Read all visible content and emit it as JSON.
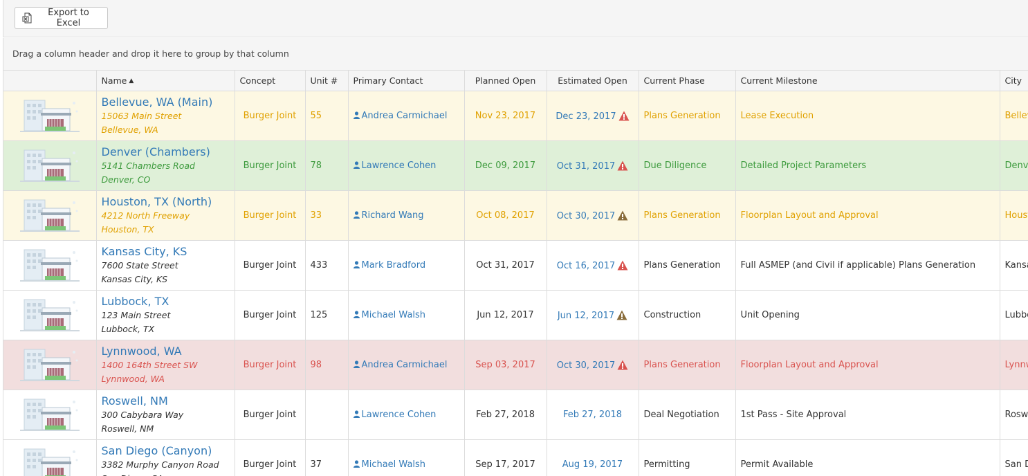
{
  "toolbar": {
    "export_label": "Export to Excel"
  },
  "group_panel": {
    "hint": "Drag a column header and drop it here to group by that column"
  },
  "columns": {
    "name": "Name",
    "concept": "Concept",
    "unit": "Unit #",
    "contact": "Primary Contact",
    "planned": "Planned Open",
    "estimated": "Estimated Open",
    "phase": "Current Phase",
    "milestone": "Current Milestone",
    "city": "City"
  },
  "sort": {
    "column": "name",
    "direction": "ascending"
  },
  "colors": {
    "link": "#337ab7",
    "warning_red": "#d9534f",
    "warning_brown": "#8a6d3b",
    "row_yellow_bg": "#fdf8e3",
    "row_green_bg": "#dff0d8",
    "row_red_bg": "#f2dede"
  },
  "rows": [
    {
      "status": "yellow",
      "name": "Bellevue, WA (Main)",
      "street": "15063 Main Street",
      "citystate": "Bellevue, WA",
      "concept": "Burger Joint",
      "unit": "55",
      "contact": "Andrea Carmichael",
      "planned": "Nov 23, 2017",
      "estimated": "Dec 23, 2017",
      "warning": "red",
      "phase": "Plans Generation",
      "milestone": "Lease Execution",
      "city": "Bellevue"
    },
    {
      "status": "green",
      "name": "Denver (Chambers)",
      "street": "5141 Chambers Road",
      "citystate": "Denver, CO",
      "concept": "Burger Joint",
      "unit": "78",
      "contact": "Lawrence Cohen",
      "planned": "Dec 09, 2017",
      "estimated": "Oct 31, 2017",
      "warning": "red",
      "phase": "Due Diligence",
      "milestone": "Detailed Project Parameters",
      "city": "Denver"
    },
    {
      "status": "yellow",
      "name": "Houston, TX (North)",
      "street": "4212 North Freeway",
      "citystate": "Houston, TX",
      "concept": "Burger Joint",
      "unit": "33",
      "contact": "Richard Wang",
      "planned": "Oct 08, 2017",
      "estimated": "Oct 30, 2017",
      "warning": "brown",
      "phase": "Plans Generation",
      "milestone": "Floorplan Layout and Approval",
      "city": "Houston"
    },
    {
      "status": "plain",
      "name": "Kansas City, KS",
      "street": "7600 State Street",
      "citystate": "Kansas City, KS",
      "concept": "Burger Joint",
      "unit": "433",
      "contact": "Mark Bradford",
      "planned": "Oct 31, 2017",
      "estimated": "Oct 16, 2017",
      "warning": "red",
      "phase": "Plans Generation",
      "milestone": "Full ASMEP (and Civil if applicable) Plans Generation",
      "city": "Kansas City"
    },
    {
      "status": "plain",
      "name": "Lubbock, TX",
      "street": "123 Main Street",
      "citystate": "Lubbock, TX",
      "concept": "Burger Joint",
      "unit": "125",
      "contact": "Michael Walsh",
      "planned": "Jun 12, 2017",
      "estimated": "Jun 12, 2017",
      "warning": "brown",
      "phase": "Construction",
      "milestone": "Unit Opening",
      "city": "Lubbock"
    },
    {
      "status": "red",
      "name": "Lynnwood, WA",
      "street": "1400 164th Street SW",
      "citystate": "Lynnwood, WA",
      "concept": "Burger Joint",
      "unit": "98",
      "contact": "Andrea Carmichael",
      "planned": "Sep 03, 2017",
      "estimated": "Oct 30, 2017",
      "warning": "red",
      "phase": "Plans Generation",
      "milestone": "Floorplan Layout and Approval",
      "city": "Lynnwood"
    },
    {
      "status": "plain",
      "name": "Roswell, NM",
      "street": "300 Cabybara Way",
      "citystate": "Roswell, NM",
      "concept": "Burger Joint",
      "unit": "",
      "contact": "Lawrence Cohen",
      "planned": "Feb 27, 2018",
      "estimated": "Feb 27, 2018",
      "warning": "",
      "phase": "Deal Negotiation",
      "milestone": "1st Pass - Site Approval",
      "city": "Roswell"
    },
    {
      "status": "plain",
      "name": "San Diego (Canyon)",
      "street": "3382 Murphy Canyon Road",
      "citystate": "San Diego, CA",
      "concept": "Burger Joint",
      "unit": "37",
      "contact": "Michael Walsh",
      "planned": "Sep 17, 2017",
      "estimated": "Aug 19, 2017",
      "warning": "",
      "phase": "Permitting",
      "milestone": "Permit Available",
      "city": "San Diego"
    }
  ]
}
